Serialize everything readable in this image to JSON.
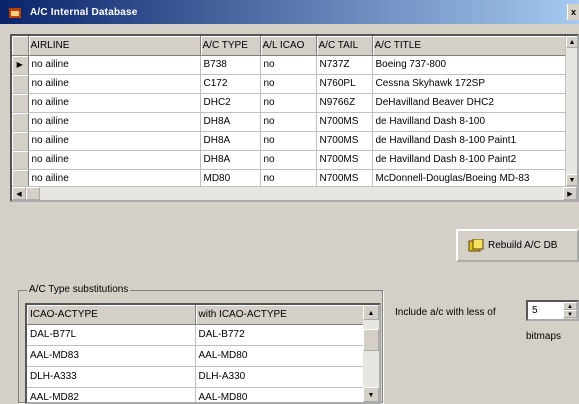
{
  "window": {
    "title": "A/C Internal Database",
    "close_glyph": "x"
  },
  "grid": {
    "columns": [
      "AIRLINE",
      "A/C TYPE",
      "A/L ICAO",
      "A/C TAIL",
      "A/C TITLE"
    ],
    "rows": [
      [
        "no ailine",
        "B738",
        "no",
        "N737Z",
        "Boeing 737-800"
      ],
      [
        "no ailine",
        "C172",
        "no",
        "N760PL",
        "Cessna Skyhawk 172SP"
      ],
      [
        "no ailine",
        "DHC2",
        "no",
        "N9766Z",
        "DeHavilland Beaver DHC2"
      ],
      [
        "no ailine",
        "DH8A",
        "no",
        "N700MS",
        "de Havilland Dash 8-100"
      ],
      [
        "no ailine",
        "DH8A",
        "no",
        "N700MS",
        "de Havilland Dash 8-100 Paint1"
      ],
      [
        "no ailine",
        "DH8A",
        "no",
        "N700MS",
        "de Havilland Dash 8-100 Paint2"
      ],
      [
        "no ailine",
        "MD80",
        "no",
        "N700MS",
        "McDonnell-Douglas/Boeing MD-83"
      ]
    ],
    "current_row_marker": "▶"
  },
  "rebuild_button": {
    "label": "Rebuild A/C DB",
    "icon": "database-icon"
  },
  "substitutions": {
    "legend": "A/C Type substitutions",
    "columns": [
      "ICAO-ACTYPE",
      "with ICAO-ACTYPE"
    ],
    "rows": [
      [
        "DAL-B77L",
        "DAL-B772"
      ],
      [
        "AAL-MD83",
        "AAL-MD80"
      ],
      [
        "DLH-A333",
        "DLH-A330"
      ],
      [
        "AAL-MD82",
        "AAL-MD80"
      ]
    ]
  },
  "include": {
    "label": "Include a/c with less of",
    "value": "5",
    "suffix": "bitmaps"
  }
}
